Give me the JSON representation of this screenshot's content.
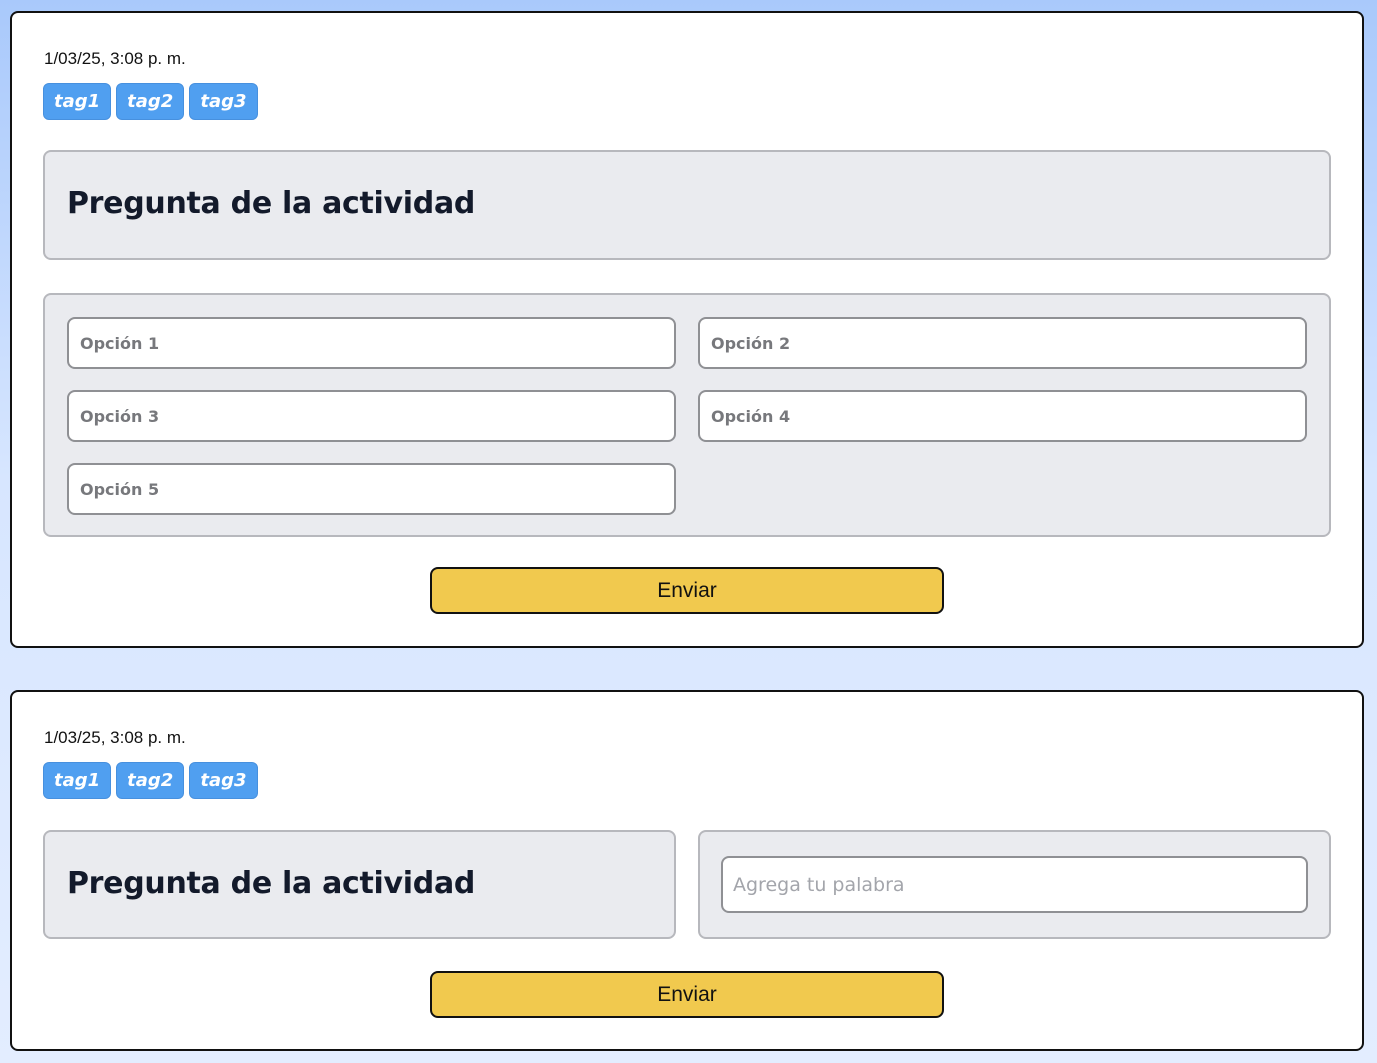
{
  "activities": [
    {
      "timestamp": "1/03/25, 3:08 p. m.",
      "tags": [
        "tag1",
        "tag2",
        "tag3"
      ],
      "question": "Pregunta de la actividad",
      "options": [
        "Opción 1",
        "Opción 2",
        "Opción 3",
        "Opción 4",
        "Opción 5"
      ],
      "submit_label": "Enviar"
    },
    {
      "timestamp": "1/03/25, 3:08 p. m.",
      "tags": [
        "tag1",
        "tag2",
        "tag3"
      ],
      "question": "Pregunta de la actividad",
      "word_placeholder": "Agrega tu palabra",
      "submit_label": "Enviar"
    }
  ],
  "colors": {
    "tag_bg": "#509ff0",
    "submit_bg": "#f1c94e",
    "panel_bg": "#eaebef",
    "title_text": "#131a2b"
  }
}
